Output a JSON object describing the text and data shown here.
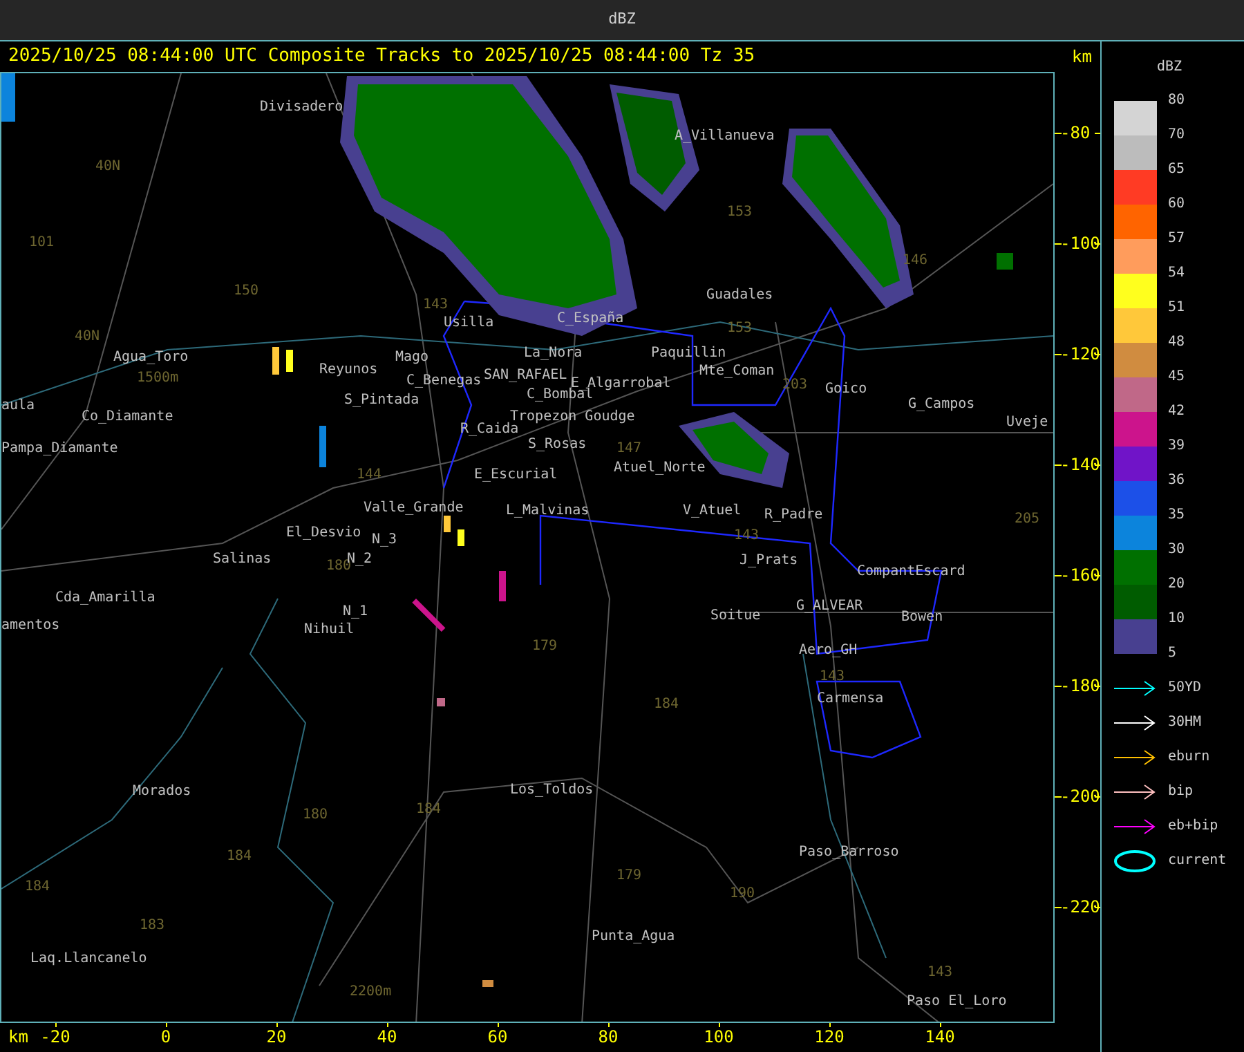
{
  "window": {
    "title": "dBZ"
  },
  "header": {
    "text": "2025/10/25 08:44:00 UTC Composite Tracks to 2025/10/25 08:44:00 Tz 35",
    "unit": "km"
  },
  "map": {
    "labels": [
      {
        "text": "Divisadero",
        "kind": "place"
      },
      {
        "text": "A_Villanueva",
        "kind": "place"
      },
      {
        "text": "40N",
        "kind": "road"
      },
      {
        "text": "101",
        "kind": "road"
      },
      {
        "text": "153",
        "kind": "road"
      },
      {
        "text": "150",
        "kind": "road"
      },
      {
        "text": "143",
        "kind": "road"
      },
      {
        "text": "146",
        "kind": "road"
      },
      {
        "text": "Guadales",
        "kind": "place"
      },
      {
        "text": "40N",
        "kind": "road"
      },
      {
        "text": "Usilla",
        "kind": "place"
      },
      {
        "text": "C_España",
        "kind": "place"
      },
      {
        "text": "153",
        "kind": "road"
      },
      {
        "text": "Agua_Toro",
        "kind": "place"
      },
      {
        "text": "1500m",
        "kind": "road"
      },
      {
        "text": "Reyunos",
        "kind": "place"
      },
      {
        "text": "Mago",
        "kind": "place"
      },
      {
        "text": "La_Nora",
        "kind": "place"
      },
      {
        "text": "Paquillin",
        "kind": "place"
      },
      {
        "text": "Mte_Coman",
        "kind": "place"
      },
      {
        "text": "203",
        "kind": "road"
      },
      {
        "text": "Goico",
        "kind": "place"
      },
      {
        "text": "G_Campos",
        "kind": "place"
      },
      {
        "text": "Uveje",
        "kind": "place"
      },
      {
        "text": "C_Benegas",
        "kind": "place"
      },
      {
        "text": "SAN_RAFAEL",
        "kind": "place"
      },
      {
        "text": "E_Algarrobal",
        "kind": "place"
      },
      {
        "text": "S_Pintada",
        "kind": "place"
      },
      {
        "text": "C_Bombal",
        "kind": "place"
      },
      {
        "text": "Tropezon Goudge",
        "kind": "place"
      },
      {
        "text": "aula",
        "kind": "place"
      },
      {
        "text": "Co_Diamante",
        "kind": "place"
      },
      {
        "text": "R_Caida",
        "kind": "place"
      },
      {
        "text": "Pampa_Diamante",
        "kind": "place"
      },
      {
        "text": "S_Rosas",
        "kind": "place"
      },
      {
        "text": "144",
        "kind": "road"
      },
      {
        "text": "147",
        "kind": "road"
      },
      {
        "text": "Atuel_Norte",
        "kind": "place"
      },
      {
        "text": "E_Escurial",
        "kind": "place"
      },
      {
        "text": "Valle_Grande",
        "kind": "place"
      },
      {
        "text": "L_Malvinas",
        "kind": "place"
      },
      {
        "text": "V_Atuel",
        "kind": "place"
      },
      {
        "text": "R_Padre",
        "kind": "place"
      },
      {
        "text": "El_Desvio",
        "kind": "place"
      },
      {
        "text": "143",
        "kind": "road"
      },
      {
        "text": "205",
        "kind": "road"
      },
      {
        "text": "N_3",
        "kind": "place"
      },
      {
        "text": "Salinas",
        "kind": "place"
      },
      {
        "text": "180",
        "kind": "road"
      },
      {
        "text": "N_2",
        "kind": "place"
      },
      {
        "text": "J_Prats",
        "kind": "place"
      },
      {
        "text": "CompantEscard",
        "kind": "place"
      },
      {
        "text": "Cda_Amarilla",
        "kind": "place"
      },
      {
        "text": "G_ALVEAR",
        "kind": "place"
      },
      {
        "text": "N_1",
        "kind": "place"
      },
      {
        "text": "Soitue",
        "kind": "place"
      },
      {
        "text": "Bowen",
        "kind": "place"
      },
      {
        "text": "amentos",
        "kind": "place"
      },
      {
        "text": "Nihuil",
        "kind": "place"
      },
      {
        "text": "179",
        "kind": "road"
      },
      {
        "text": "Aero_GH",
        "kind": "place"
      },
      {
        "text": "143",
        "kind": "road"
      },
      {
        "text": "184",
        "kind": "road"
      },
      {
        "text": "Carmensa",
        "kind": "place"
      },
      {
        "text": "Morados",
        "kind": "place"
      },
      {
        "text": "Los_Toldos",
        "kind": "place"
      },
      {
        "text": "180",
        "kind": "road"
      },
      {
        "text": "184",
        "kind": "road"
      },
      {
        "text": "184",
        "kind": "road"
      },
      {
        "text": "Paso_Barroso",
        "kind": "place"
      },
      {
        "text": "179",
        "kind": "road"
      },
      {
        "text": "190",
        "kind": "road"
      },
      {
        "text": "184",
        "kind": "road"
      },
      {
        "text": "183",
        "kind": "road"
      },
      {
        "text": "Punta_Agua",
        "kind": "place"
      },
      {
        "text": "Laq.Llancanelo",
        "kind": "place"
      },
      {
        "text": "2200m",
        "kind": "road"
      },
      {
        "text": "143",
        "kind": "road"
      },
      {
        "text": "Paso El_Loro",
        "kind": "place"
      }
    ]
  },
  "y_axis": {
    "ticks": [
      "-80",
      "-100",
      "-120",
      "-140",
      "-160",
      "-180",
      "-200",
      "-220"
    ]
  },
  "x_axis": {
    "unit": "km",
    "ticks": [
      "-20",
      "0",
      "20",
      "40",
      "60",
      "80",
      "100",
      "120",
      "140"
    ]
  },
  "legend": {
    "title": "dBZ",
    "swatches": [
      {
        "color": "#d4d4d4"
      },
      {
        "color": "#bcbcbc"
      },
      {
        "color": "#ff3b24"
      },
      {
        "color": "#ff6400"
      },
      {
        "color": "#ff9c5c"
      },
      {
        "color": "#ffff1e"
      },
      {
        "color": "#ffc83a"
      },
      {
        "color": "#d08c40"
      },
      {
        "color": "#c06888"
      },
      {
        "color": "#cc148c"
      },
      {
        "color": "#7014c8"
      },
      {
        "color": "#1c50e8"
      },
      {
        "color": "#0c84dc"
      },
      {
        "color": "#007000"
      },
      {
        "color": "#005c00"
      },
      {
        "color": "#484090"
      }
    ],
    "levels": [
      "80",
      "70",
      "65",
      "60",
      "57",
      "54",
      "51",
      "48",
      "45",
      "42",
      "39",
      "36",
      "35",
      "30",
      "20",
      "10",
      "5"
    ],
    "tracks": [
      {
        "label": "50YD",
        "color": "#00ffff",
        "kind": "arrow"
      },
      {
        "label": "30HM",
        "color": "#ffffff",
        "kind": "arrow"
      },
      {
        "label": "eburn",
        "color": "#ffc000",
        "kind": "arrow"
      },
      {
        "label": "bip",
        "color": "#ffc0c0",
        "kind": "arrow"
      },
      {
        "label": "eb+bip",
        "color": "#ff00ff",
        "kind": "arrow"
      },
      {
        "label": "current",
        "color": "#00ffff",
        "kind": "ellipse"
      }
    ]
  }
}
